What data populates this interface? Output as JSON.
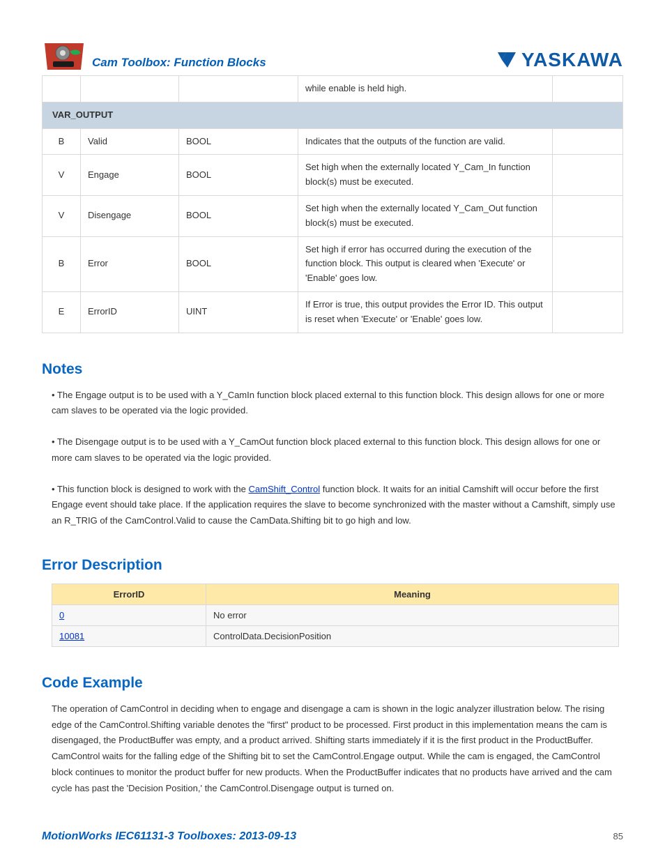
{
  "header": {
    "title": "Cam Toolbox: Function Blocks",
    "brand": "YASKAWA"
  },
  "table1": {
    "row_prev": {
      "c0": "",
      "c1": "",
      "c2": "",
      "c3": "while enable is held high.",
      "c4": ""
    },
    "section_label": "VAR_OUTPUT",
    "rows": [
      {
        "c0": "B",
        "c1": "Valid",
        "c2": "BOOL",
        "c3": "Indicates that the outputs of the function are valid.",
        "c4": ""
      },
      {
        "c0": "V",
        "c1": "Engage",
        "c2": "BOOL",
        "c3": "Set high when the externally located Y_Cam_In function block(s) must be executed.",
        "c4": ""
      },
      {
        "c0": "V",
        "c1": "Disengage",
        "c2": "BOOL",
        "c3": "Set high when the externally located Y_Cam_Out function block(s) must be executed.",
        "c4": ""
      },
      {
        "c0": "B",
        "c1": "Error",
        "c2": "BOOL",
        "c3": "Set high if error has occurred during the execution of the function block. This output is cleared when 'Execute' or 'Enable' goes low.",
        "c4": ""
      },
      {
        "c0": "E",
        "c1": "ErrorID",
        "c2": "UINT",
        "c3": "If Error is true, this output provides the Error ID. This output is reset when 'Execute' or 'Enable' goes low.",
        "c4": ""
      }
    ]
  },
  "sections": {
    "notes_heading": "Notes",
    "notes": {
      "p1": "• The Engage output is to be used with a Y_CamIn function block placed external to this function block.  This design allows for one or more cam slaves to be operated via the logic provided.",
      "p2": "• The Disengage output is to be used with a Y_CamOut function block placed external to this function block.  This design allows for one or more cam slaves to be operated via the logic provided.",
      "p3_pre": "• This function block is designed to work with the ",
      "p3_link": "CamShift_Control",
      "p3_post": " function block.  It waits for an initial Camshift will occur before the first Engage event should take place.  If the application requires the slave to become synchronized with the master without a Camshift, simply use an R_TRIG of the CamControl.Valid to cause the CamData.Shifting bit to go high and low."
    },
    "error_heading": "Error Description",
    "error_table": {
      "h1": "ErrorID",
      "h2": "Meaning",
      "rows": [
        {
          "id": "0",
          "meaning": "No error"
        },
        {
          "id": "10081",
          "meaning": "ControlData.DecisionPosition"
        }
      ]
    },
    "code_heading": "Code Example",
    "code_text": "The operation of CamControl in deciding when to engage and disengage a cam is shown in the logic analyzer illustration below.  The rising edge of the CamControl.Shifting variable denotes the \"first\" product to be processed.  First product in this implementation means the cam is disengaged, the ProductBuffer was empty, and a product arrived.  Shifting starts immediately if it is the first product in the ProductBuffer.  CamControl waits for the falling edge of the Shifting bit to set the CamControl.Engage output.  While the cam is engaged, the CamControl block continues to monitor the product buffer for new products.  When the ProductBuffer indicates that no products have arrived and the cam cycle has past the 'Decision Position,' the CamControl.Disengage output is turned on."
  },
  "footer": {
    "left": "MotionWorks IEC61131-3 Toolboxes: 2013-09-13",
    "page": "85"
  }
}
